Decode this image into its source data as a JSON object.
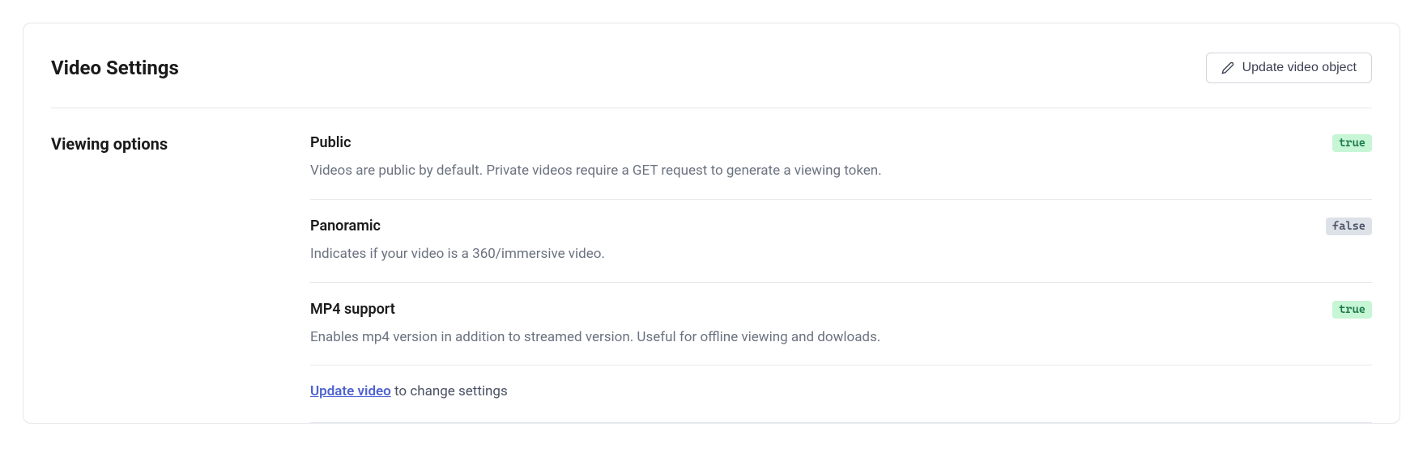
{
  "card": {
    "title": "Video Settings",
    "update_button_label": "Update video object"
  },
  "section": {
    "label": "Viewing options"
  },
  "settings": {
    "public": {
      "name": "Public",
      "description": "Videos are public by default. Private videos require a GET request to generate a viewing token.",
      "value": "true"
    },
    "panoramic": {
      "name": "Panoramic",
      "description": "Indicates if your video is a 360/immersive video.",
      "value": "false"
    },
    "mp4": {
      "name": "MP4 support",
      "description": "Enables mp4 version in addition to streamed version. Useful for offline viewing and dowloads.",
      "value": "true"
    }
  },
  "footer": {
    "link_text": "Update video",
    "after_text": " to change settings"
  }
}
